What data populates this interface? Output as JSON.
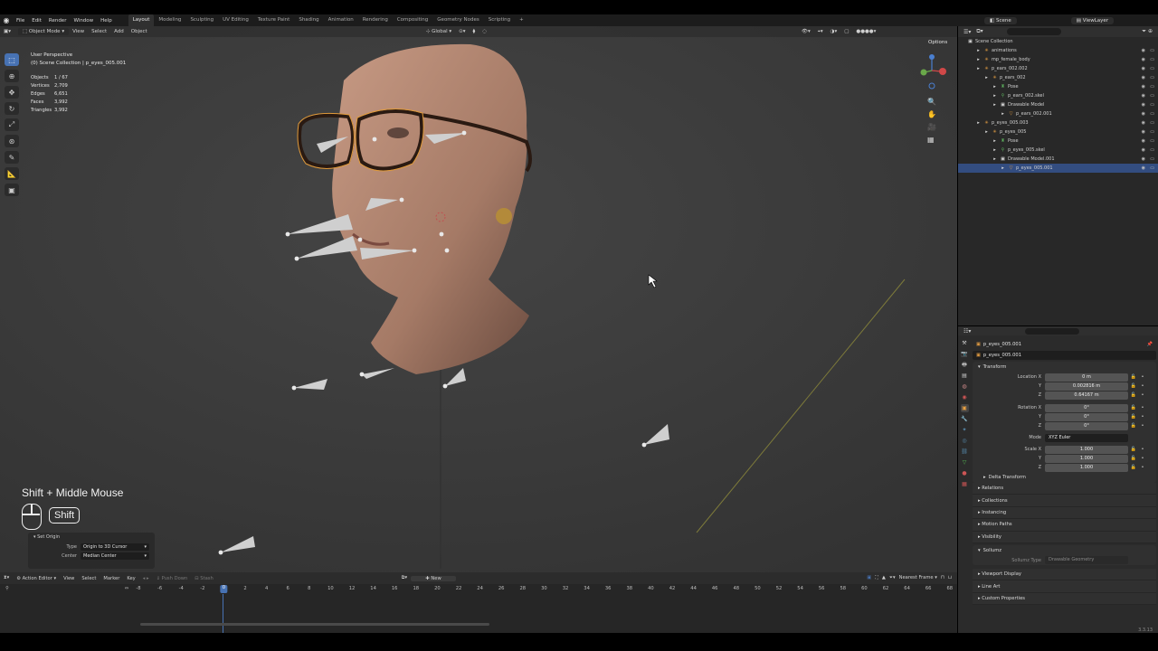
{
  "menubar": {
    "menus": [
      "File",
      "Edit",
      "Render",
      "Window",
      "Help"
    ],
    "workspaces": [
      "Layout",
      "Modeling",
      "Sculpting",
      "UV Editing",
      "Texture Paint",
      "Shading",
      "Animation",
      "Rendering",
      "Compositing",
      "Geometry Nodes",
      "Scripting"
    ],
    "active_workspace": "Layout",
    "scene": "Scene",
    "view_layer": "ViewLayer"
  },
  "viewport": {
    "mode": "Object Mode",
    "menus": [
      "View",
      "Select",
      "Add",
      "Object"
    ],
    "orientation": "Global",
    "options_label": "Options",
    "perspective": "User Perspective",
    "collection_line": "(0) Scene Collection | p_eyes_005.001",
    "stats": [
      {
        "label": "Objects",
        "value": "1 / 67"
      },
      {
        "label": "Vertices",
        "value": "2,709"
      },
      {
        "label": "Edges",
        "value": "6,651"
      },
      {
        "label": "Faces",
        "value": "3,992"
      },
      {
        "label": "Triangles",
        "value": "3,992"
      }
    ],
    "shortcut_text": "Shift + Middle Mouse",
    "shortcut_key": "Shift",
    "redo_panel": {
      "title": "Set Origin",
      "type_label": "Type",
      "type_value": "Origin to 3D Cursor",
      "center_label": "Center",
      "center_value": "Median Center"
    }
  },
  "outliner": {
    "root": "Scene Collection",
    "rows": [
      {
        "label": "animations",
        "indent": 1,
        "icon": "armature-icon"
      },
      {
        "label": "mp_female_body",
        "indent": 1,
        "icon": "armature-icon"
      },
      {
        "label": "p_ears_002.002",
        "indent": 1,
        "icon": "armature-icon"
      },
      {
        "label": "p_ears_002",
        "indent": 2,
        "icon": "armature-icon"
      },
      {
        "label": "Pose",
        "indent": 3,
        "icon": "pose-icon"
      },
      {
        "label": "p_ears_002.skel",
        "indent": 3,
        "icon": "armature-data-icon"
      },
      {
        "label": "Drawable Model",
        "indent": 3,
        "icon": "collection-icon"
      },
      {
        "label": "p_ears_002.001",
        "indent": 4,
        "icon": "mesh-icon"
      },
      {
        "label": "p_eyes_005.003",
        "indent": 1,
        "icon": "armature-icon"
      },
      {
        "label": "p_eyes_005",
        "indent": 2,
        "icon": "armature-icon"
      },
      {
        "label": "Pose",
        "indent": 3,
        "icon": "pose-icon"
      },
      {
        "label": "p_eyes_005.skel",
        "indent": 3,
        "icon": "armature-data-icon"
      },
      {
        "label": "Drawable Model.001",
        "indent": 3,
        "icon": "collection-icon"
      },
      {
        "label": "p_eyes_005.001",
        "indent": 4,
        "icon": "mesh-icon",
        "selected": true
      }
    ]
  },
  "properties": {
    "breadcrumb": "p_eyes_005.001",
    "object_name": "p_eyes_005.001",
    "transform": {
      "title": "Transform",
      "location_label": "Location X",
      "location": [
        "0 m",
        "0.002816 m",
        "0.64167 m"
      ],
      "rotation_label": "Rotation X",
      "rotation": [
        "0°",
        "0°",
        "0°"
      ],
      "mode_label": "Mode",
      "mode_value": "XYZ Euler",
      "scale_label": "Scale X",
      "scale": [
        "1.000",
        "1.000",
        "1.000"
      ],
      "axis_y": "Y",
      "axis_z": "Z"
    },
    "delta_transform": "Delta Transform",
    "sections": [
      "Relations",
      "Collections",
      "Instancing",
      "Motion Paths",
      "Visibility"
    ],
    "sollumz": {
      "title": "Sollumz",
      "type_label": "Sollumz Type",
      "type_value": "Drawable Geometry"
    },
    "sections_after": [
      "Viewport Display",
      "Line Art",
      "Custom Properties"
    ]
  },
  "timeline": {
    "editor": "Action Editor",
    "menus": [
      "View",
      "Select",
      "Marker",
      "Key"
    ],
    "push_down": "Push Down",
    "stash": "Stash",
    "new_label": "New",
    "snap": "Nearest Frame",
    "current_frame": "0",
    "ticks": [
      "-8",
      "-6",
      "-4",
      "-2",
      "0",
      "2",
      "4",
      "6",
      "8",
      "10",
      "12",
      "14",
      "16",
      "18",
      "20",
      "22",
      "24",
      "26",
      "28",
      "30",
      "32",
      "34",
      "36",
      "38",
      "40",
      "42",
      "44",
      "46",
      "48",
      "50",
      "52",
      "54",
      "56",
      "58",
      "60",
      "62",
      "64",
      "66",
      "68"
    ]
  },
  "status": {
    "version": "3.3.13"
  },
  "colors": {
    "accent": "#4772b3",
    "selection": "#334d80",
    "viewport_bg": "#3c3c3c",
    "panel_bg": "#2b2b2b"
  }
}
